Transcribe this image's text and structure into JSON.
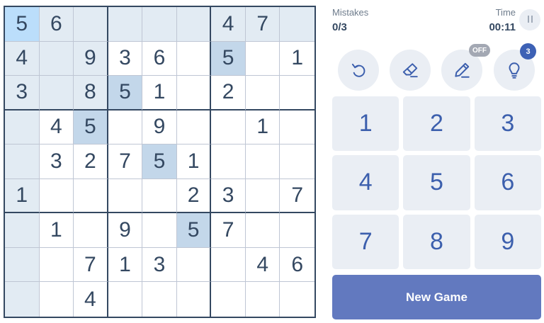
{
  "board": {
    "rows": [
      [
        "5",
        "6",
        "",
        "",
        "",
        "",
        "4",
        "7",
        ""
      ],
      [
        "4",
        "",
        "9",
        "3",
        "6",
        "",
        "5",
        "",
        "1"
      ],
      [
        "3",
        "",
        "8",
        "5",
        "1",
        "",
        "2",
        "",
        ""
      ],
      [
        "",
        "4",
        "5",
        "",
        "9",
        "",
        "",
        "1",
        ""
      ],
      [
        "",
        "3",
        "2",
        "7",
        "5",
        "1",
        "",
        "",
        ""
      ],
      [
        "1",
        "",
        "",
        "",
        "",
        "2",
        "3",
        "",
        "7"
      ],
      [
        "",
        "1",
        "",
        "9",
        "",
        "5",
        "7",
        "",
        ""
      ],
      [
        "",
        "",
        "7",
        "1",
        "3",
        "",
        "",
        "4",
        "6"
      ],
      [
        "",
        "",
        "4",
        "",
        "",
        "",
        "",
        "",
        ""
      ]
    ],
    "selected": [
      0,
      0
    ]
  },
  "status": {
    "mistakes_label": "Mistakes",
    "mistakes_value": "0/3",
    "time_label": "Time",
    "time_value": "00:11"
  },
  "tools": {
    "pencil_state": "OFF",
    "hint_count": "3"
  },
  "numpad": [
    "1",
    "2",
    "3",
    "4",
    "5",
    "6",
    "7",
    "8",
    "9"
  ],
  "new_game_label": "New Game",
  "colors": {
    "grid_bold": "#344861",
    "grid_thin": "#bfc6d4",
    "related_highlight": "#e2ebf3",
    "same_number_highlight": "#c3d7ea",
    "selected_cell": "#bbdefb",
    "number_blue": "#3c5fad",
    "button_bg": "#eaeef4",
    "new_game_bg": "#6279bf",
    "hint_badge": "#3d61b5",
    "pencil_badge": "#a3a8b3"
  }
}
